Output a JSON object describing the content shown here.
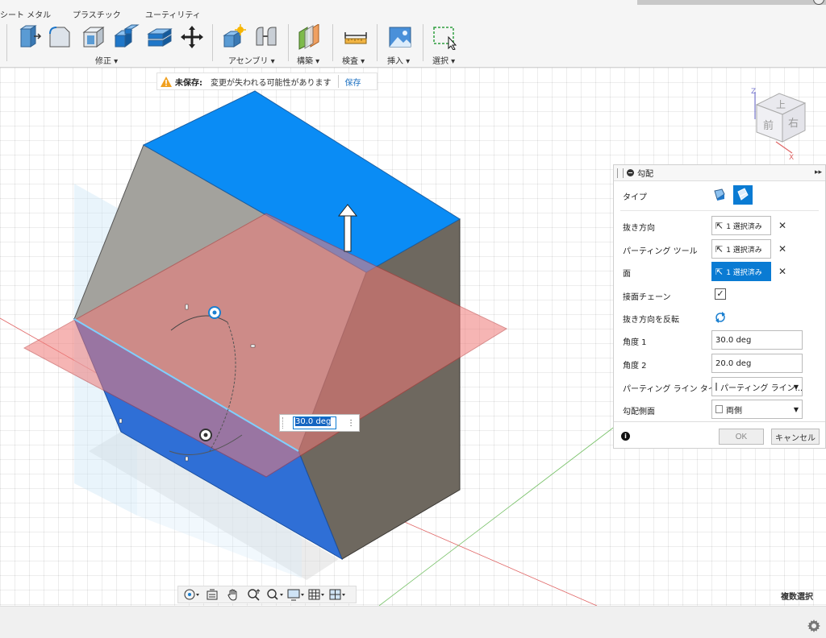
{
  "toolbar": {
    "tabs": [
      "シート メタル",
      "プラスチック",
      "ユーティリティ"
    ],
    "groups": {
      "modify": "修正 ▾",
      "assemble": "アセンブリ ▾",
      "construct": "構築 ▾",
      "inspect": "検査 ▾",
      "insert": "挿入 ▾",
      "select": "選択 ▾"
    }
  },
  "unsaved_banner": {
    "label": "未保存:",
    "message": "変更が失われる可能性があります",
    "save": "保存"
  },
  "viewcube": {
    "top": "上",
    "front": "前",
    "right": "右",
    "axis_z": "Z",
    "axis_x": "X"
  },
  "dialog": {
    "title": "勾配",
    "rows": {
      "type": "タイプ",
      "pull_direction": "抜き方向",
      "parting_tool": "パーティング ツール",
      "faces": "面",
      "tangent_chain": "接面チェーン",
      "flip_pull": "抜き方向を反転",
      "angle1": "角度 1",
      "angle2": "角度 2",
      "parting_line_type": "パーティング ライン タイプ",
      "draft_side": "勾配側面"
    },
    "selected": "1 選択済み",
    "angle1_value": "30.0 deg",
    "angle2_value": "20.0 deg",
    "parting_line_type_value": "パーティング ライン...",
    "draft_side_value": "両側",
    "tangent_chain_checked": true,
    "ok": "OK",
    "cancel": "キャンセル"
  },
  "viewport": {
    "angle_input_value": "30.0 deg",
    "multi_select": "複数選択"
  },
  "colors": {
    "selected_face": "#0a8cf5",
    "parting_plane": "#f07a78",
    "body_dark": "#6e685f",
    "accent": "#0a7bd3"
  }
}
